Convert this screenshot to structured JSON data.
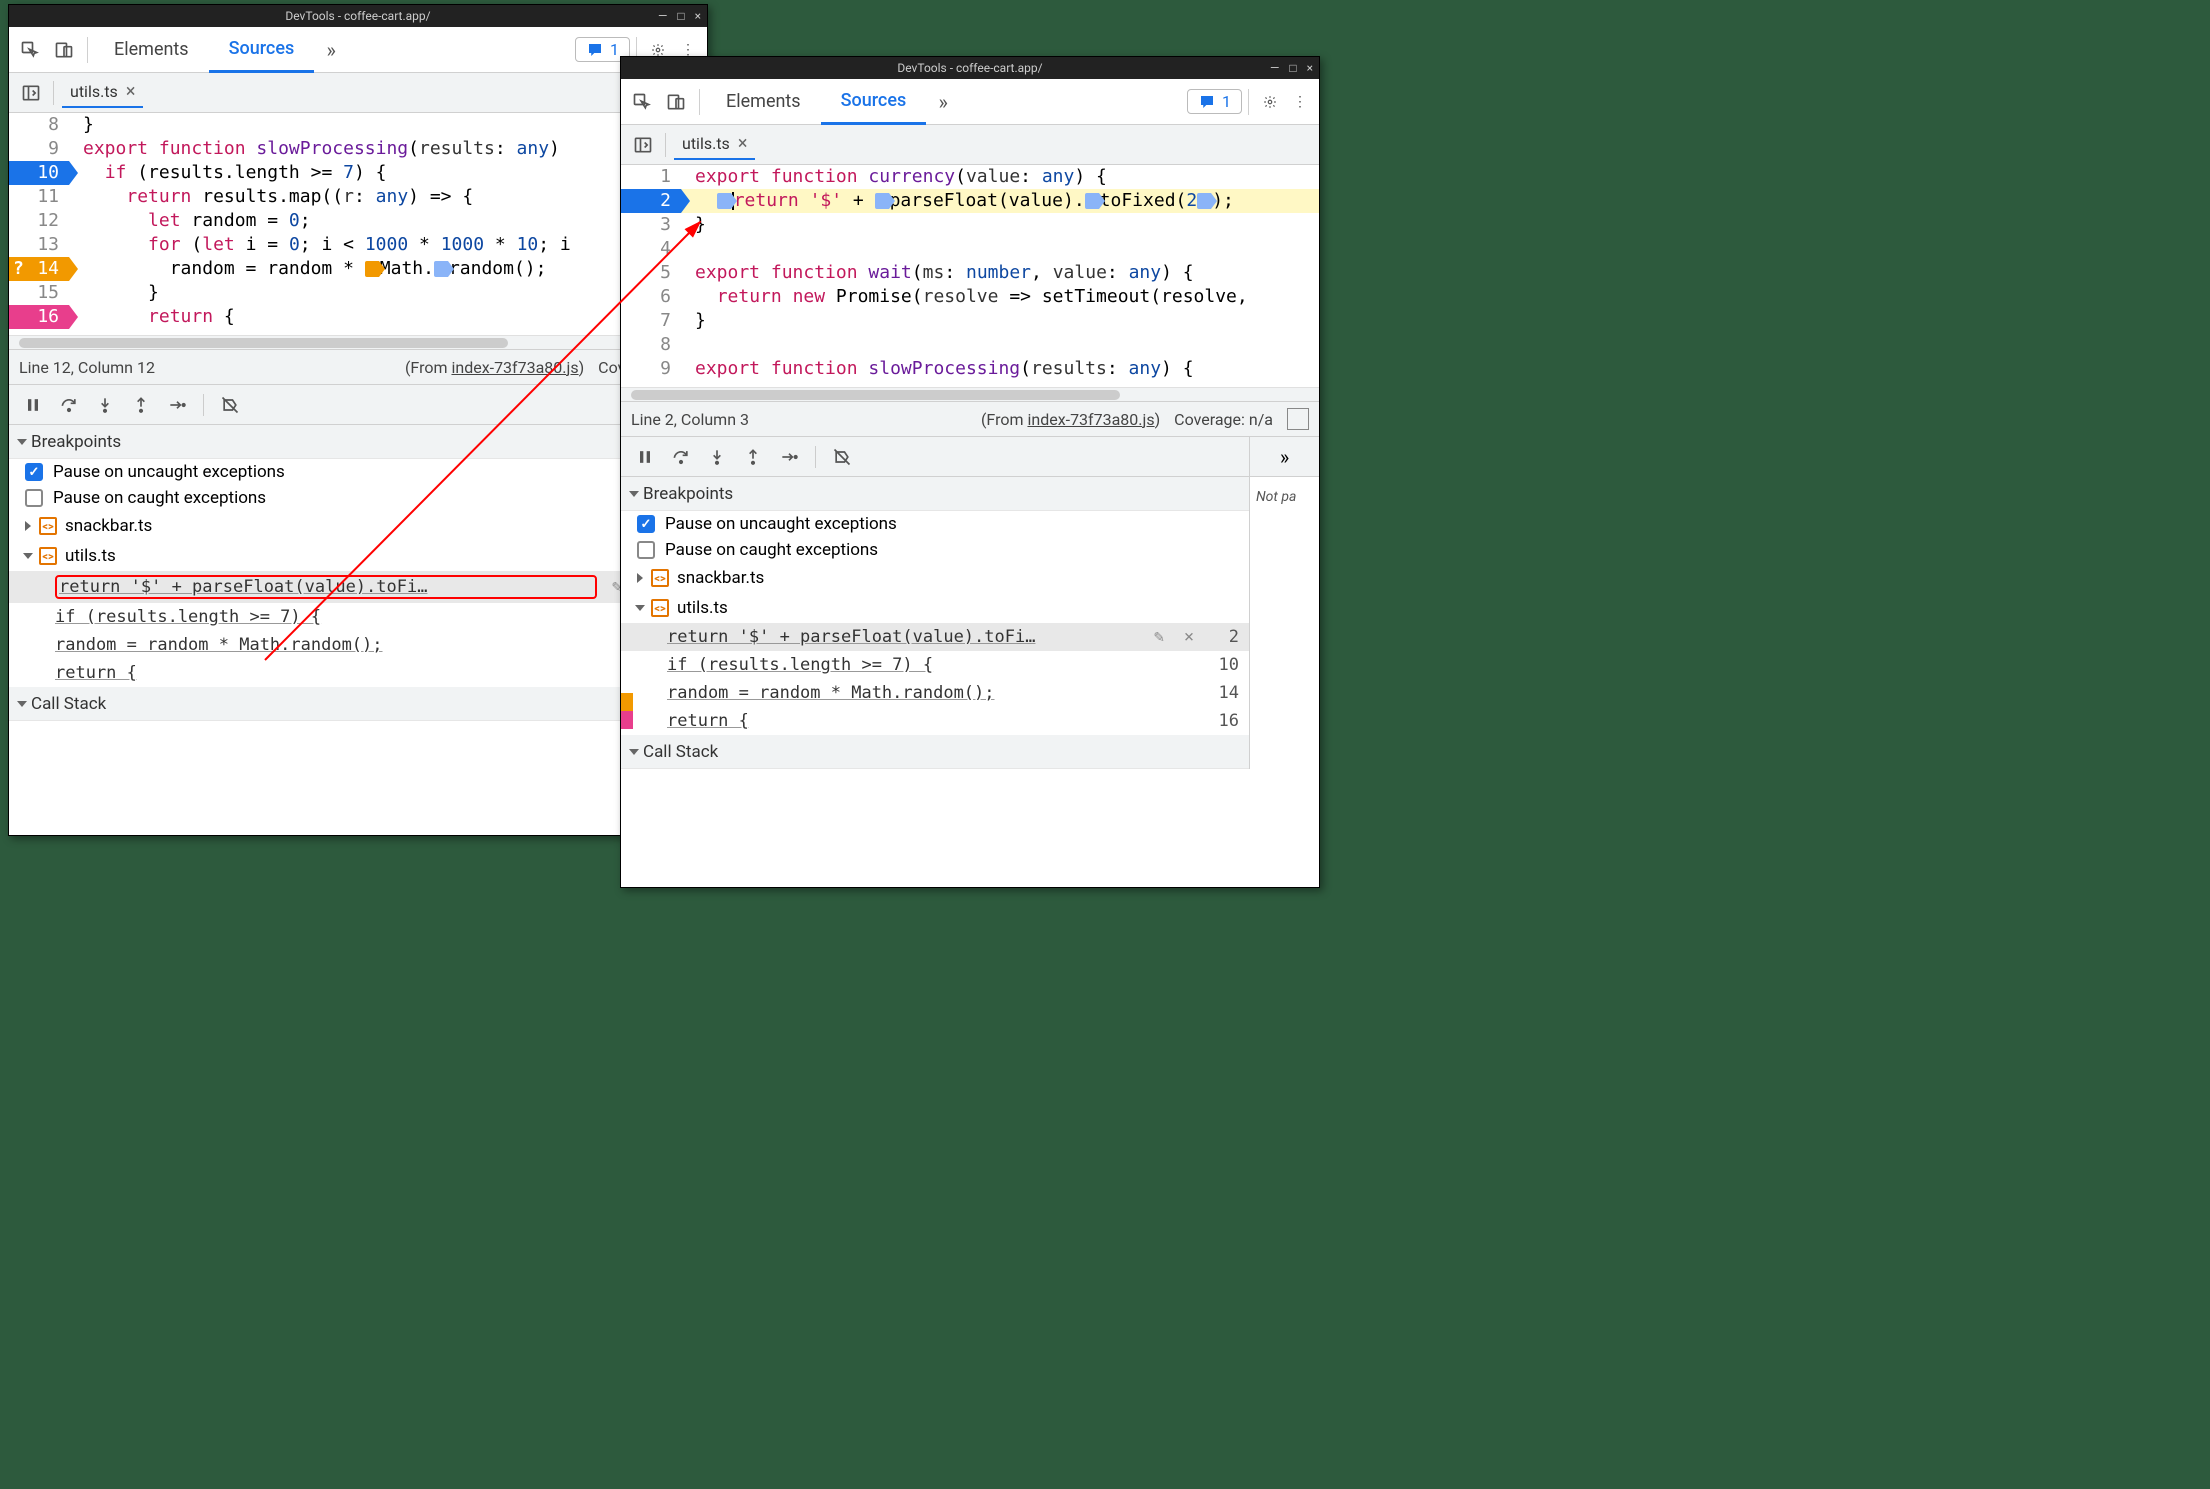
{
  "title": "DevTools - coffee-cart.app/",
  "tabs": {
    "elements": "Elements",
    "sources": "Sources"
  },
  "issues_count": "1",
  "file_tab": "utils.ts",
  "win1": {
    "status_line": "Line 12, Column 12",
    "status_from": "(From ",
    "status_link": "index-73f73a80.js",
    "status_after": ")",
    "coverage": "Coverage: n/a",
    "code_lines": [
      {
        "n": "8",
        "txt": "}"
      },
      {
        "n": "9",
        "txt_html": "<span class='kw-export'>export</span> <span class='kw-func'>function</span> <span class='fn-name'>slowProcessing</span>(<span class='pale'>results</span>: <span class='kw-type'>any</span>)"
      },
      {
        "n": "10",
        "bp": "blue",
        "txt_html": "  <span class='kw-if'>if</span> (results.length >= <span class='num'>7</span>) {"
      },
      {
        "n": "11",
        "txt_html": "    <span class='kw-return'>return</span> results.map((<span class='pale'>r</span>: <span class='kw-type'>any</span>) => {"
      },
      {
        "n": "12",
        "txt_html": "      <span class='kw-let'>let</span> random = <span class='num'>0</span>;"
      },
      {
        "n": "13",
        "txt_html": "      <span class='kw-for'>for</span> (<span class='kw-let'>let</span> i = <span class='num'>0</span>; i < <span class='num'>1000</span> * <span class='num'>1000</span> * <span class='num'>10</span>; i"
      },
      {
        "n": "14",
        "bp": "orange",
        "q": true,
        "txt_html": "        random = random * <span class='marker orange'></span>Math.<span class='marker'></span>random();"
      },
      {
        "n": "15",
        "txt_html": "      }"
      },
      {
        "n": "16",
        "bp": "pink",
        "txt_html": "      <span class='kw-return'>return</span> {"
      }
    ]
  },
  "win2": {
    "status_line": "Line 2, Column 3",
    "status_from": "(From ",
    "status_link": "index-73f73a80.js",
    "status_after": ")",
    "coverage": "Coverage: n/a",
    "not_paused": "Not pa",
    "code_lines": [
      {
        "n": "1",
        "txt_html": "<span class='kw-export'>export</span> <span class='kw-func'>function</span> <span class='fn-name'>currency</span>(<span class='pale'>value</span>: <span class='kw-type'>any</span>) {"
      },
      {
        "n": "2",
        "bp": "blue",
        "hl": true,
        "txt_html": "  <span class='marker'></span><span class='cursor-mark'></span><span class='kw-return'>return</span> <span class='str'>'$'</span> + <span class='marker'></span>parseFloat(value).<span class='marker'></span>toFixed(<span class='num'>2</span><span class='marker'></span>);"
      },
      {
        "n": "3",
        "txt": "}"
      },
      {
        "n": "4",
        "txt": ""
      },
      {
        "n": "5",
        "txt_html": "<span class='kw-export'>export</span> <span class='kw-func'>function</span> <span class='fn-name'>wait</span>(<span class='pale'>ms</span>: <span class='kw-type'>number</span>, <span class='pale'>value</span>: <span class='kw-type'>any</span>) {"
      },
      {
        "n": "6",
        "txt_html": "  <span class='kw-return'>return</span> <span class='kw-new'>new</span> Promise(<span class='pale'>resolve</span> => setTimeout(resolve,"
      },
      {
        "n": "7",
        "txt": "}"
      },
      {
        "n": "8",
        "txt": ""
      },
      {
        "n": "9",
        "txt_html": "<span class='kw-export'>export</span> <span class='kw-func'>function</span> <span class='fn-name'>slowProcessing</span>(<span class='pale'>results</span>: <span class='kw-type'>any</span>) {"
      }
    ]
  },
  "bp_section": {
    "header": "Breakpoints",
    "pause_uncaught": "Pause on uncaught exceptions",
    "pause_caught": "Pause on caught exceptions",
    "file1": "snackbar.ts",
    "file2": "utils.ts",
    "rows": [
      {
        "txt": "return '$' + parseFloat(value).toFi…",
        "ln": "2",
        "edit": true
      },
      {
        "txt": "if (results.length >= 7) {",
        "ln": "10"
      },
      {
        "txt": "random = random * Math.random();",
        "ln": "14"
      },
      {
        "txt": "return {",
        "ln": "16"
      }
    ]
  },
  "callstack": "Call Stack"
}
